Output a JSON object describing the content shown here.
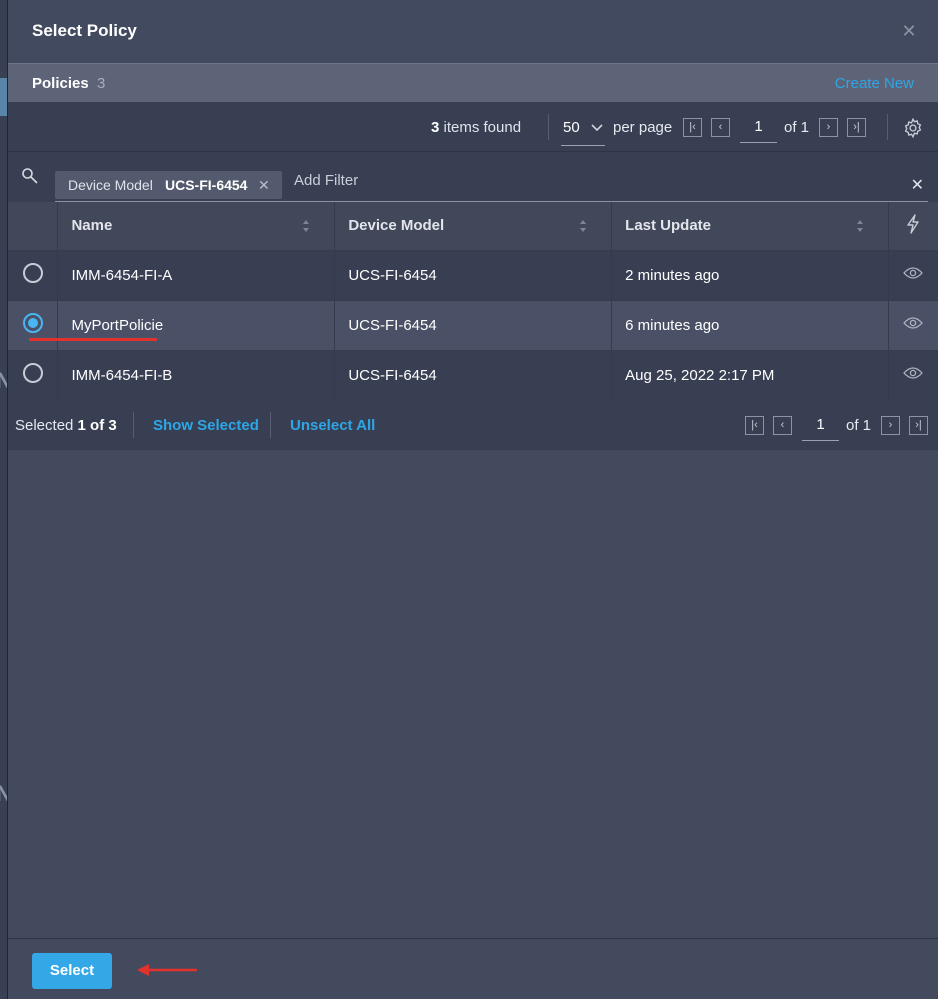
{
  "modal": {
    "title": "Select Policy",
    "close_icon": "close-icon"
  },
  "policies_bar": {
    "label": "Policies",
    "count": "3",
    "create_new": "Create New"
  },
  "toolbar": {
    "items_found_count": "3",
    "items_found_suffix": " items found",
    "per_page_value": "50",
    "per_page_label": "per page",
    "page_current": "1",
    "page_of": "of 1"
  },
  "filter": {
    "chip_key": "Device Model",
    "chip_value": "UCS-FI-6454",
    "add_filter_placeholder": "Add Filter"
  },
  "table": {
    "columns": [
      "Name",
      "Device Model",
      "Last Update"
    ],
    "rows": [
      {
        "name": "IMM-6454-FI-A",
        "model": "UCS-FI-6454",
        "updated": "2 minutes ago",
        "selected": false
      },
      {
        "name": "MyPortPolicie",
        "model": "UCS-FI-6454",
        "updated": "6 minutes ago",
        "selected": true
      },
      {
        "name": "IMM-6454-FI-B",
        "model": "UCS-FI-6454",
        "updated": "Aug 25, 2022 2:17 PM",
        "selected": false
      }
    ]
  },
  "footer": {
    "selected_prefix": "Selected ",
    "selected_count": "1 of 3",
    "show_selected": "Show Selected",
    "unselect_all": "Unselect All",
    "page_current": "1",
    "page_of": "of 1"
  },
  "actions": {
    "select_label": "Select"
  },
  "colors": {
    "accent": "#34a8e6",
    "link": "#2ea6e6",
    "annotation": "#e3312b"
  }
}
